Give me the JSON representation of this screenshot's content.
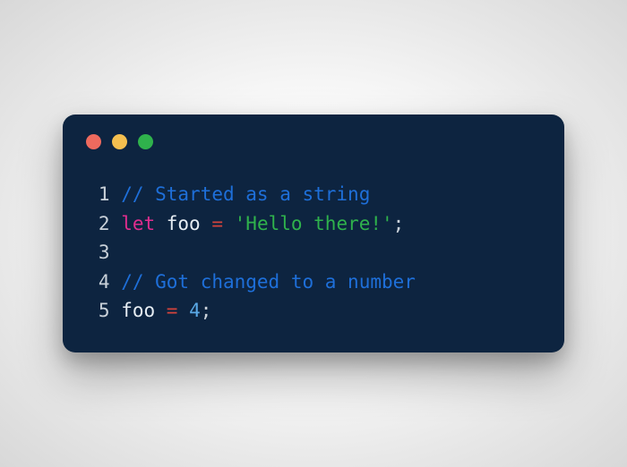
{
  "traffic_lights": {
    "close": "#ed6a5e",
    "minimize": "#f4bf4f",
    "zoom": "#2fb24c"
  },
  "code": {
    "lines": [
      {
        "n": "1",
        "tokens": [
          {
            "cls": "c-comment",
            "t": "// Started as a string"
          }
        ]
      },
      {
        "n": "2",
        "tokens": [
          {
            "cls": "c-keyword",
            "t": "let"
          },
          {
            "cls": "c-ident",
            "t": " foo "
          },
          {
            "cls": "c-op",
            "t": "="
          },
          {
            "cls": "c-ident",
            "t": " "
          },
          {
            "cls": "c-string",
            "t": "'Hello there!'"
          },
          {
            "cls": "c-punct",
            "t": ";"
          }
        ]
      },
      {
        "n": "3",
        "tokens": []
      },
      {
        "n": "4",
        "tokens": [
          {
            "cls": "c-comment",
            "t": "// Got changed to a number"
          }
        ]
      },
      {
        "n": "5",
        "tokens": [
          {
            "cls": "c-ident",
            "t": "foo "
          },
          {
            "cls": "c-op",
            "t": "="
          },
          {
            "cls": "c-ident",
            "t": " "
          },
          {
            "cls": "c-number",
            "t": "4"
          },
          {
            "cls": "c-punct",
            "t": ";"
          }
        ]
      }
    ]
  }
}
